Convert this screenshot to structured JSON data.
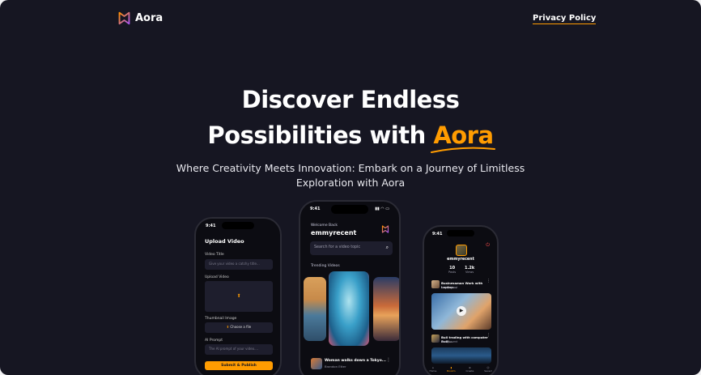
{
  "brand": {
    "name": "Aora",
    "accent": "#FF9C01",
    "bg": "#161622"
  },
  "header": {
    "privacy_label": "Privacy Policy"
  },
  "hero": {
    "line1": "Discover Endless",
    "line2_prefix": "Possibilities with ",
    "line2_accent": "Aora",
    "subtitle_line1": "Where Creativity Meets Innovation: Embark on a Journey of Limitless",
    "subtitle_line2": "Exploration with Aora"
  },
  "phone_left": {
    "time": "9:41",
    "title": "Upload Video",
    "video_title_label": "Video Title",
    "video_title_placeholder": "Give your video a catchy title...",
    "upload_label": "Upload Video",
    "thumbnail_label": "Thumbnail Image",
    "choose_file": "Choose a file",
    "prompt_label": "AI Prompt",
    "prompt_placeholder": "The AI prompt of your video....",
    "submit": "Submit & Publish"
  },
  "phone_center": {
    "time": "9:41",
    "welcome": "Welcome Back",
    "username": "emmyrecent",
    "search_placeholder": "Search for a video topic",
    "trending": "Trending Videos",
    "video_title": "Woman walks down a Tokyo...",
    "video_author": "Brandon Etter"
  },
  "phone_right": {
    "time": "9:41",
    "username": "emmyrecent",
    "posts_value": "10",
    "posts_label": "Posts",
    "views_value": "1.2k",
    "views_label": "Views",
    "row1_title": "Businessman Work with Laptop...",
    "row1_author": "emmyrecent",
    "row2_title": "Bull trading with computer Bulli...",
    "row2_author": "emmyrecent",
    "nav": [
      "Home",
      "Bookm",
      "Create",
      "Saved"
    ]
  }
}
